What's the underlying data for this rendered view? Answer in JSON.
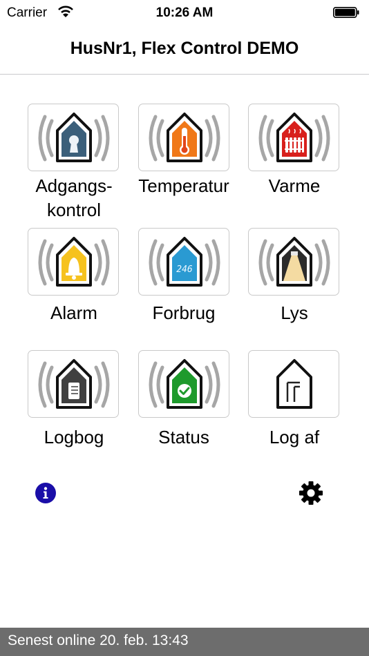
{
  "status_bar": {
    "carrier": "Carrier",
    "time": "10:26 AM"
  },
  "nav": {
    "title": "HusNr1, Flex Control DEMO"
  },
  "tiles": [
    {
      "label_line1": "Adgangs-",
      "label_line2": "kontrol",
      "icon": "access-control-icon"
    },
    {
      "label": "Temperatur",
      "icon": "thermometer-icon"
    },
    {
      "label": "Varme",
      "icon": "radiator-icon"
    },
    {
      "label": "Alarm",
      "icon": "alarm-bell-icon"
    },
    {
      "label": "Forbrug",
      "icon": "consumption-display-icon",
      "display_value": "246"
    },
    {
      "label": "Lys",
      "icon": "light-icon"
    },
    {
      "label": "Logbog",
      "icon": "logbook-icon"
    },
    {
      "label": "Status",
      "icon": "status-check-icon"
    },
    {
      "label": "Log af",
      "icon": "logout-icon"
    }
  ],
  "footer": {
    "text": "Senest online 20. feb. 13:43"
  },
  "colors": {
    "footer_bg": "#6d6d6d",
    "info_blue": "#1a0ea8",
    "radio_wave_gray": "#a6a6a6"
  }
}
